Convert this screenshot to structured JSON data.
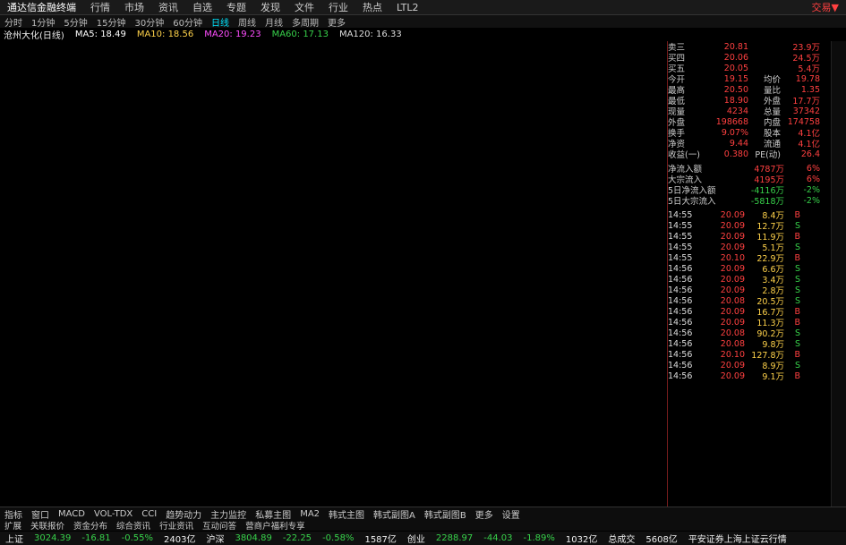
{
  "menubar": {
    "app_title": "通达信金融终端",
    "items": [
      "行情",
      "市场",
      "资讯",
      "自选",
      "专题",
      "发现",
      "文件",
      "行业",
      "热点",
      "LTL2"
    ],
    "right_link": "交易▼"
  },
  "periodbar": {
    "items": [
      "分时",
      "1分钟",
      "5分钟",
      "15分钟",
      "30分钟",
      "60分钟",
      "日线",
      "周线",
      "月线",
      "多周期",
      "更多"
    ],
    "active_index": 6
  },
  "legend": {
    "stock": "沧州大化(日线)",
    "mas": [
      {
        "label": "MA5: 18.49",
        "color": "#ffffff"
      },
      {
        "label": "MA10: 18.56",
        "color": "#ffd24a"
      },
      {
        "label": "MA20: 19.23",
        "color": "#ff4dff"
      },
      {
        "label": "MA60: 17.13",
        "color": "#37d14a"
      },
      {
        "label": "MA120: 16.33",
        "color": "#dddddd"
      }
    ]
  },
  "quote": {
    "rows": [
      [
        "卖三",
        "20.81",
        "",
        "23.9万"
      ],
      [
        "买四",
        "20.06",
        "",
        "24.5万"
      ],
      [
        "买五",
        "20.05",
        "",
        "5.4万"
      ],
      [
        "今开",
        "19.15",
        "均价",
        "19.78"
      ],
      [
        "最高",
        "20.50",
        "量比",
        "1.35"
      ],
      [
        "最低",
        "18.90",
        "外盘",
        "17.7万"
      ],
      [
        "现量",
        "4234",
        "总量",
        "37342"
      ],
      [
        "外盘",
        "198668",
        "内盘",
        "174758"
      ],
      [
        "换手",
        "9.07%",
        "股本",
        "4.1亿"
      ],
      [
        "净资",
        "9.44",
        "流通",
        "4.1亿"
      ],
      [
        "收益(一)",
        "0.380",
        "PE(动)",
        "26.4"
      ]
    ],
    "flows": [
      [
        "净流入额",
        "4787万",
        "6%"
      ],
      [
        "大宗流入",
        "4195万",
        "6%"
      ],
      [
        "5日净流入额",
        "-4116万",
        "-2%"
      ],
      [
        "5日大宗流入",
        "-5818万",
        "-2%"
      ]
    ],
    "ticks": [
      [
        "14:55",
        "20.09",
        "8.4万",
        "B"
      ],
      [
        "14:55",
        "20.09",
        "12.7万",
        "S"
      ],
      [
        "14:55",
        "20.09",
        "11.9万",
        "B"
      ],
      [
        "14:55",
        "20.09",
        "5.1万",
        "S"
      ],
      [
        "14:55",
        "20.10",
        "22.9万",
        "B"
      ],
      [
        "14:56",
        "20.09",
        "6.6万",
        "S"
      ],
      [
        "14:56",
        "20.09",
        "3.4万",
        "S"
      ],
      [
        "14:56",
        "20.09",
        "2.8万",
        "S"
      ],
      [
        "14:56",
        "20.08",
        "20.5万",
        "S"
      ],
      [
        "14:56",
        "20.09",
        "16.7万",
        "B"
      ],
      [
        "14:56",
        "20.09",
        "11.3万",
        "B"
      ],
      [
        "14:56",
        "20.08",
        "90.2万",
        "S"
      ],
      [
        "14:56",
        "20.08",
        "9.8万",
        "S"
      ],
      [
        "14:56",
        "20.10",
        "127.8万",
        "B"
      ],
      [
        "14:56",
        "20.09",
        "8.9万",
        "S"
      ],
      [
        "14:56",
        "20.09",
        "9.1万",
        "B"
      ]
    ]
  },
  "tabs": [
    "指标",
    "窗口",
    "MACD",
    "VOL-TDX",
    "CCI",
    "趋势动力",
    "主力监控",
    "私募主图",
    "MA2",
    "韩式主图",
    "韩式副图A",
    "韩式副图B",
    "更多",
    "设置"
  ],
  "tabs2": [
    "扩展",
    "关联报价",
    "资金分布",
    "综合资讯",
    "行业资讯",
    "互动问答",
    "营商户福利专享"
  ],
  "status": {
    "items": [
      {
        "text": "上证",
        "cls": "wht"
      },
      {
        "text": "3024.39",
        "cls": "grn"
      },
      {
        "text": "-16.81",
        "cls": "grn"
      },
      {
        "text": "-0.55%",
        "cls": "grn"
      },
      {
        "text": "2403亿",
        "cls": "wht"
      },
      {
        "text": "沪深",
        "cls": "wht"
      },
      {
        "text": "3804.89",
        "cls": "grn"
      },
      {
        "text": "-22.25",
        "cls": "grn"
      },
      {
        "text": "-0.58%",
        "cls": "grn"
      },
      {
        "text": "1587亿",
        "cls": "wht"
      },
      {
        "text": "创业",
        "cls": "wht"
      },
      {
        "text": "2288.97",
        "cls": "grn"
      },
      {
        "text": "-44.03",
        "cls": "grn"
      },
      {
        "text": "-1.89%",
        "cls": "grn"
      },
      {
        "text": "1032亿",
        "cls": "wht"
      },
      {
        "text": "总成交",
        "cls": "wht"
      },
      {
        "text": "5608亿",
        "cls": "wht"
      },
      {
        "text": "平安证券上海上证云行情",
        "cls": "wht"
      }
    ]
  }
}
